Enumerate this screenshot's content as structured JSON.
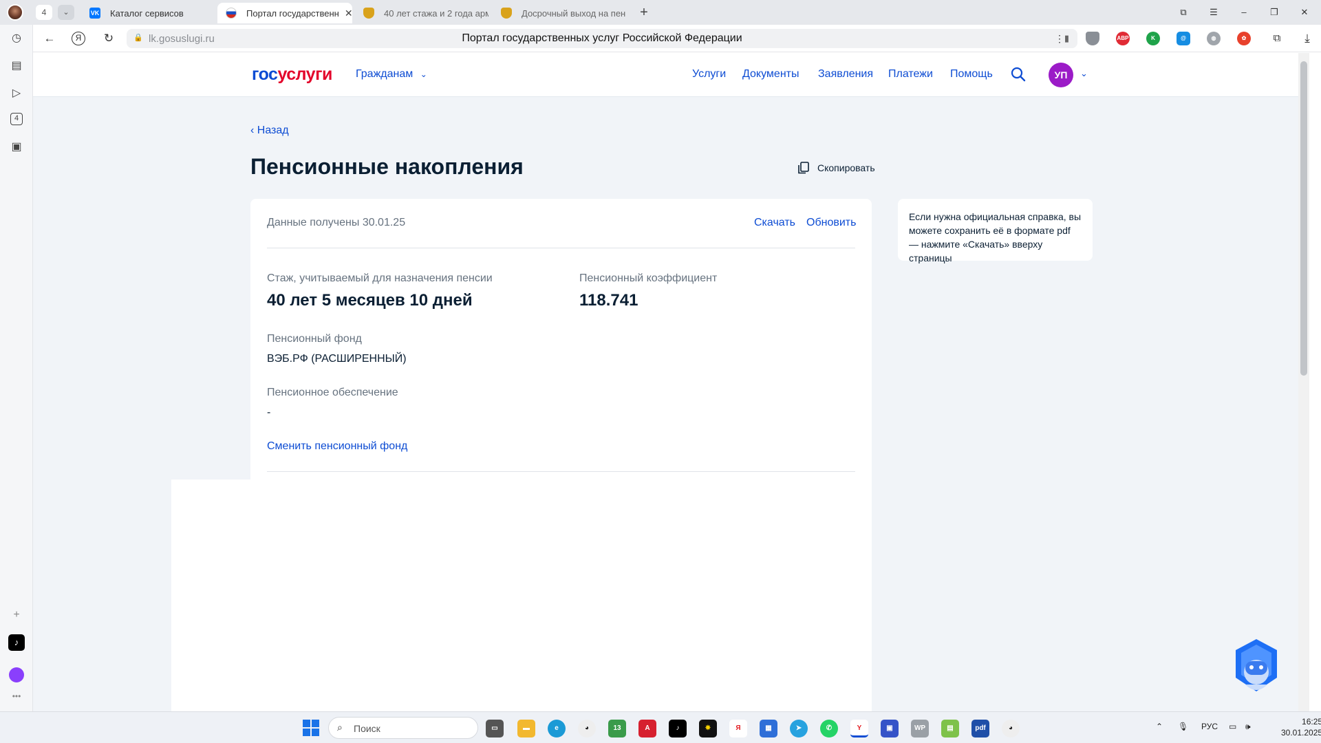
{
  "browser": {
    "tab_count": "4",
    "tabs": [
      {
        "label": "Каталог сервисов",
        "favicon": "VK"
      },
      {
        "label": "Портал государственн",
        "favicon": "flag"
      },
      {
        "label": "40 лет стажа и 2 года арм",
        "favicon": "shield"
      },
      {
        "label": "Досрочный выход на пен",
        "favicon": "shield"
      }
    ],
    "address_domain": "lk.gosuslugi.ru",
    "page_title": "Портал государственных услуг Российской Федерации",
    "extensions": [
      "shield-icon",
      "adblock-icon",
      "kaspersky-icon",
      "mail-icon",
      "globe-icon",
      "flower-icon",
      "collections-icon",
      "download-icon"
    ]
  },
  "site": {
    "logo_part1": "гос",
    "logo_part2": "услуги",
    "audience": "Гражданам",
    "nav": [
      "Услуги",
      "Документы",
      "Заявления",
      "Платежи",
      "Помощь"
    ],
    "avatar_initials": "УП"
  },
  "page": {
    "back": "Назад",
    "title": "Пенсионные накопления",
    "copy": "Скопировать",
    "received": "Данные получены 30.01.25",
    "download": "Скачать",
    "refresh": "Обновить",
    "seniority_label": "Стаж, учитываемый для назначения пенсии",
    "seniority_value": "40 лет 5 месяцев 10 дней",
    "coef_label": "Пенсионный коэффициент",
    "coef_value": "118.741",
    "fund_label": "Пенсионный фонд",
    "fund_value": "ВЭБ.РФ (РАСШИРЕННЫЙ)",
    "provision_label": "Пенсионное обеспечение",
    "provision_value": "-",
    "change_fund": "Сменить пенсионный фонд",
    "info_text": "Если нужна официальная справка, вы можете сохранить её в формате pdf — нажмите «Скачать» вверху страницы"
  },
  "taskbar": {
    "search_placeholder": "Поиск",
    "lang": "РУС",
    "time": "16:25",
    "date": "30.01.2025"
  },
  "colors": {
    "brand_blue": "#0d4cd3",
    "brand_red": "#e3052b",
    "avatar": "#9b1bc7"
  }
}
